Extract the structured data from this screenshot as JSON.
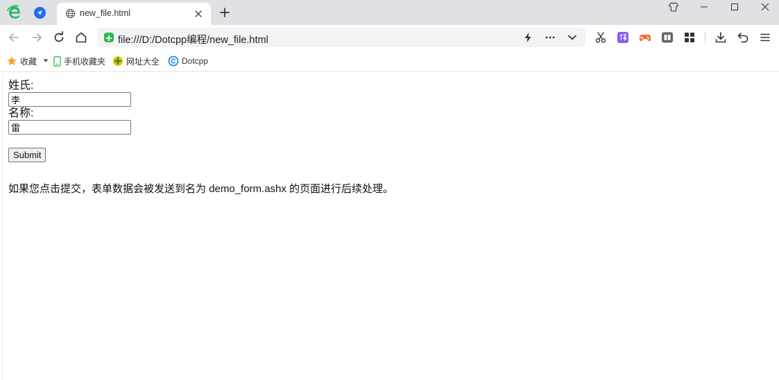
{
  "browser": {
    "tab": {
      "title": "new_file.html"
    },
    "address_bar": {
      "url": "file:///D:/Dotcpp编程/new_file.html"
    },
    "bookmarks": [
      {
        "label": "收藏",
        "icon": "star-icon"
      },
      {
        "label": "手机收藏夹",
        "icon": "phone-icon"
      },
      {
        "label": "网址大全",
        "icon": "web-directory-icon"
      },
      {
        "label": "Dotcpp",
        "icon": "dotcpp-icon"
      }
    ],
    "colors": {
      "accent_green": "#2db84d",
      "brand_green": "#19b55b",
      "star_orange": "#f5a623",
      "tab_strip": "#dfe1e5"
    }
  },
  "form": {
    "surname_label": "姓氏:",
    "surname_value": "李",
    "name_label": "名称:",
    "name_value": "雷",
    "submit_label": "Submit"
  },
  "note": "如果您点击提交，表单数据会被发送到名为 demo_form.ashx 的页面进行后续处理。"
}
